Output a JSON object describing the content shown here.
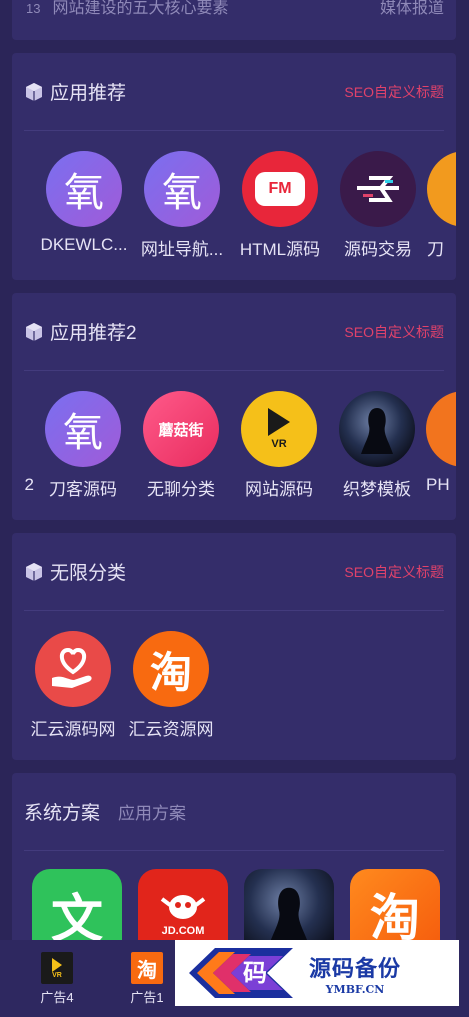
{
  "news_top": {
    "number": "13",
    "title": "网站建设的五大核心要素",
    "category": "媒体报道"
  },
  "sections": [
    {
      "title": "应用推荐",
      "more": "SEO自定义标题",
      "apps": [
        {
          "label": "DKEWLC...",
          "icon": "oxygen-logo-icon"
        },
        {
          "label": "网址导航...",
          "icon": "oxygen-logo-icon"
        },
        {
          "label": "HTML源码",
          "icon": "fm-radio-icon"
        },
        {
          "label": "源码交易",
          "icon": "glitch-logo-icon"
        },
        {
          "label": "刀",
          "icon": "orange-partial-icon"
        }
      ]
    },
    {
      "title": "应用推荐2",
      "more": "SEO自定义标题",
      "apps": [
        {
          "label": "2",
          "icon": "none"
        },
        {
          "label": "刀客源码",
          "icon": "oxygen-logo-icon"
        },
        {
          "label": "无聊分类",
          "icon": "mogujie-icon"
        },
        {
          "label": "网站源码",
          "icon": "vr-play-icon"
        },
        {
          "label": "织梦模板",
          "icon": "silhouette-icon"
        },
        {
          "label": "PH",
          "icon": "orange-partial-icon"
        }
      ]
    },
    {
      "title": "无限分类",
      "more": "SEO自定义标题",
      "apps": [
        {
          "label": "汇云源码网",
          "icon": "heart-hand-icon"
        },
        {
          "label": "汇云资源网",
          "icon": "taobao-icon"
        }
      ]
    }
  ],
  "solutions": {
    "tab_active": "系统方案",
    "tab_other": "应用方案",
    "icons": [
      "wen-doc-icon",
      "jd-com-icon",
      "silhouette-icon",
      "taobao-icon"
    ],
    "jd_text": "JD.COM",
    "wen_char": "文"
  },
  "bottom_bar": {
    "items": [
      {
        "label": "广告4",
        "icon": "vr-play-icon"
      },
      {
        "label": "广告1",
        "icon": "taobao-icon"
      }
    ]
  },
  "banner": {
    "chinese": "源码备份",
    "english": "YMBF.CN",
    "logo_char": "码"
  },
  "glyphs": {
    "oxygen": "氧",
    "taobao": "淘",
    "mogujie": "蘑菇街",
    "fm": "FM",
    "vr": "VR"
  },
  "colors": {
    "accent": "#e0426a",
    "bg": "#2b2558",
    "card": "#342d6a"
  }
}
